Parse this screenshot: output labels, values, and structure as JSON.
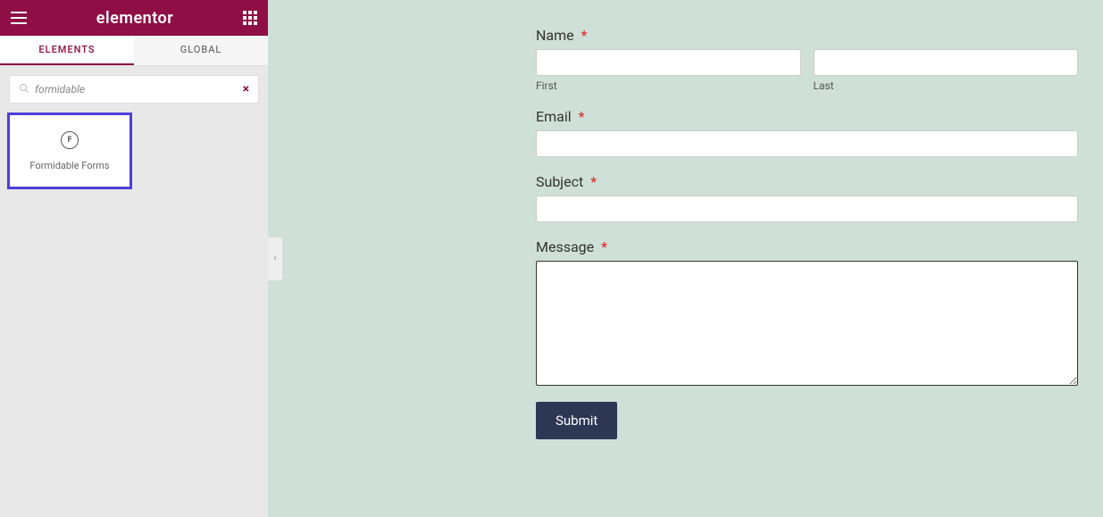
{
  "header": {
    "brand": "elementor"
  },
  "tabs": {
    "elements": "ELEMENTS",
    "global": "GLOBAL"
  },
  "search": {
    "value": "formidable",
    "clear": "×"
  },
  "widget": {
    "label": "Formidable Forms",
    "icon_glyph": "F"
  },
  "collapse": {
    "glyph": "‹"
  },
  "form": {
    "name": {
      "label": "Name",
      "req": "*",
      "first": "First",
      "last": "Last"
    },
    "email": {
      "label": "Email",
      "req": "*"
    },
    "subject": {
      "label": "Subject",
      "req": "*"
    },
    "message": {
      "label": "Message",
      "req": "*"
    },
    "submit": "Submit"
  }
}
